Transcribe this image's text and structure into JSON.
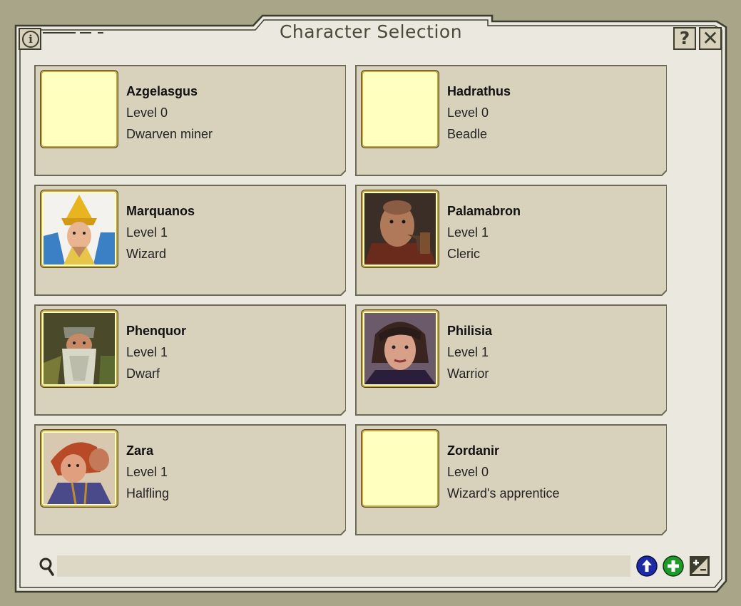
{
  "window": {
    "title": "Character Selection",
    "info_icon": "info-icon",
    "help_label": "?",
    "close_label": "✕"
  },
  "characters": [
    {
      "name": "Azgelasgus",
      "level": "Level 0",
      "class": "Dwarven miner",
      "portrait": "empty"
    },
    {
      "name": "Hadrathus",
      "level": "Level 0",
      "class": "Beadle",
      "portrait": "empty"
    },
    {
      "name": "Marquanos",
      "level": "Level 1",
      "class": "Wizard",
      "portrait": "wizard-portrait"
    },
    {
      "name": "Palamabron",
      "level": "Level 1",
      "class": "Cleric",
      "portrait": "cleric-portrait"
    },
    {
      "name": "Phenquor",
      "level": "Level 1",
      "class": "Dwarf",
      "portrait": "dwarf-portrait"
    },
    {
      "name": "Philisia",
      "level": "Level 1",
      "class": "Warrior",
      "portrait": "warrior-portrait"
    },
    {
      "name": "Zara",
      "level": "Level 1",
      "class": "Halfling",
      "portrait": "halfling-portrait"
    },
    {
      "name": "Zordanir",
      "level": "Level 0",
      "class": "Wizard's apprentice",
      "portrait": "empty"
    }
  ],
  "footer": {
    "search_value": "",
    "search_icon": "search-icon",
    "import_icon": "arrow-up-icon",
    "add_icon": "plus-icon",
    "edit_icon": "edit-icon"
  },
  "colors": {
    "background": "#a8a588",
    "panel": "#ebe8e0",
    "card": "#d8d2bd",
    "frame": "#5e5e48",
    "portrait_empty": "#ffffc0",
    "portrait_border": "#c9a53a",
    "import_blue": "#1c2aa8",
    "add_green": "#1f9a2a"
  }
}
